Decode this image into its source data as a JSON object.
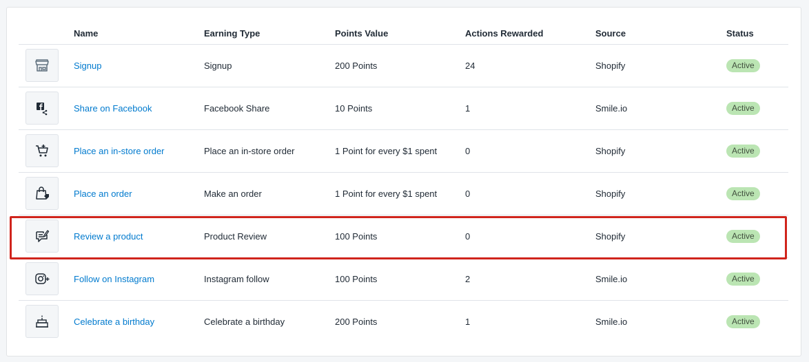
{
  "table": {
    "headers": {
      "name": "Name",
      "earning_type": "Earning Type",
      "points_value": "Points Value",
      "actions_rewarded": "Actions Rewarded",
      "source": "Source",
      "status": "Status"
    },
    "rows": [
      {
        "icon": "storefront-icon",
        "name": "Signup",
        "earning_type": "Signup",
        "points_value": "200 Points",
        "actions_rewarded": "24",
        "source": "Shopify",
        "status": "Active"
      },
      {
        "icon": "facebook-share-icon",
        "name": "Share on Facebook",
        "earning_type": "Facebook Share",
        "points_value": "10 Points",
        "actions_rewarded": "1",
        "source": "Smile.io",
        "status": "Active"
      },
      {
        "icon": "shopping-cart-icon",
        "name": "Place an in-store order",
        "earning_type": "Place an in-store order",
        "points_value": "1 Point for every $1 spent",
        "actions_rewarded": "0",
        "source": "Shopify",
        "status": "Active"
      },
      {
        "icon": "shopping-bag-icon",
        "name": "Place an order",
        "earning_type": "Make an order",
        "points_value": "1 Point for every $1 spent",
        "actions_rewarded": "0",
        "source": "Shopify",
        "status": "Active"
      },
      {
        "icon": "review-icon",
        "name": "Review a product",
        "earning_type": "Product Review",
        "points_value": "100 Points",
        "actions_rewarded": "0",
        "source": "Shopify",
        "status": "Active"
      },
      {
        "icon": "instagram-follow-icon",
        "name": "Follow on Instagram",
        "earning_type": "Instagram follow",
        "points_value": "100 Points",
        "actions_rewarded": "2",
        "source": "Smile.io",
        "status": "Active"
      },
      {
        "icon": "birthday-cake-icon",
        "name": "Celebrate a birthday",
        "earning_type": "Celebrate a birthday",
        "points_value": "200 Points",
        "actions_rewarded": "1",
        "source": "Smile.io",
        "status": "Active"
      }
    ]
  },
  "colors": {
    "link": "#007ace",
    "badge_bg": "#bbe5b3",
    "highlight_border": "#d0241c"
  }
}
